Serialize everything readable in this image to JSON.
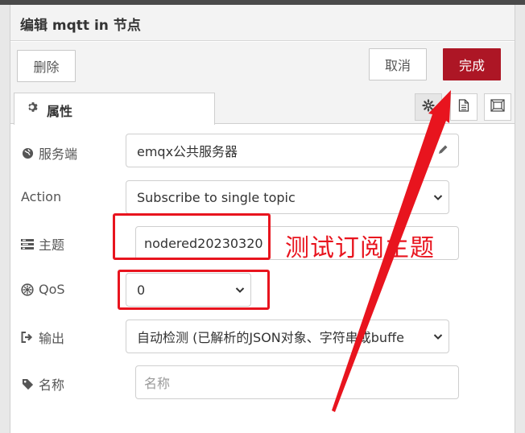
{
  "header": {
    "title": "编辑 mqtt in 节点"
  },
  "toolbar": {
    "delete_label": "删除",
    "cancel_label": "取消",
    "done_label": "完成"
  },
  "tabs": {
    "properties_label": "属性"
  },
  "form": {
    "server": {
      "label": "服务端",
      "value": "emqx公共服务器"
    },
    "action": {
      "label": "Action",
      "value": "Subscribe to single topic"
    },
    "topic": {
      "label": "主题",
      "value": "nodered20230320"
    },
    "qos": {
      "label": "QoS",
      "value": "0"
    },
    "output": {
      "label": "输出",
      "value": "自动检测 (已解析的JSON对象、字符串或buffe"
    },
    "name": {
      "label": "名称",
      "placeholder": "名称"
    }
  },
  "annotation": {
    "text": "测试订阅主题"
  },
  "colors": {
    "accent": "#ad1625",
    "annotation_red": "#e8141e"
  },
  "icons": [
    "gear-icon",
    "document-icon",
    "frame-icon",
    "globe-icon",
    "pencil-icon",
    "tasks-icon",
    "qos-icon",
    "sign-out-icon",
    "tag-icon",
    "chevron-down-icon"
  ]
}
